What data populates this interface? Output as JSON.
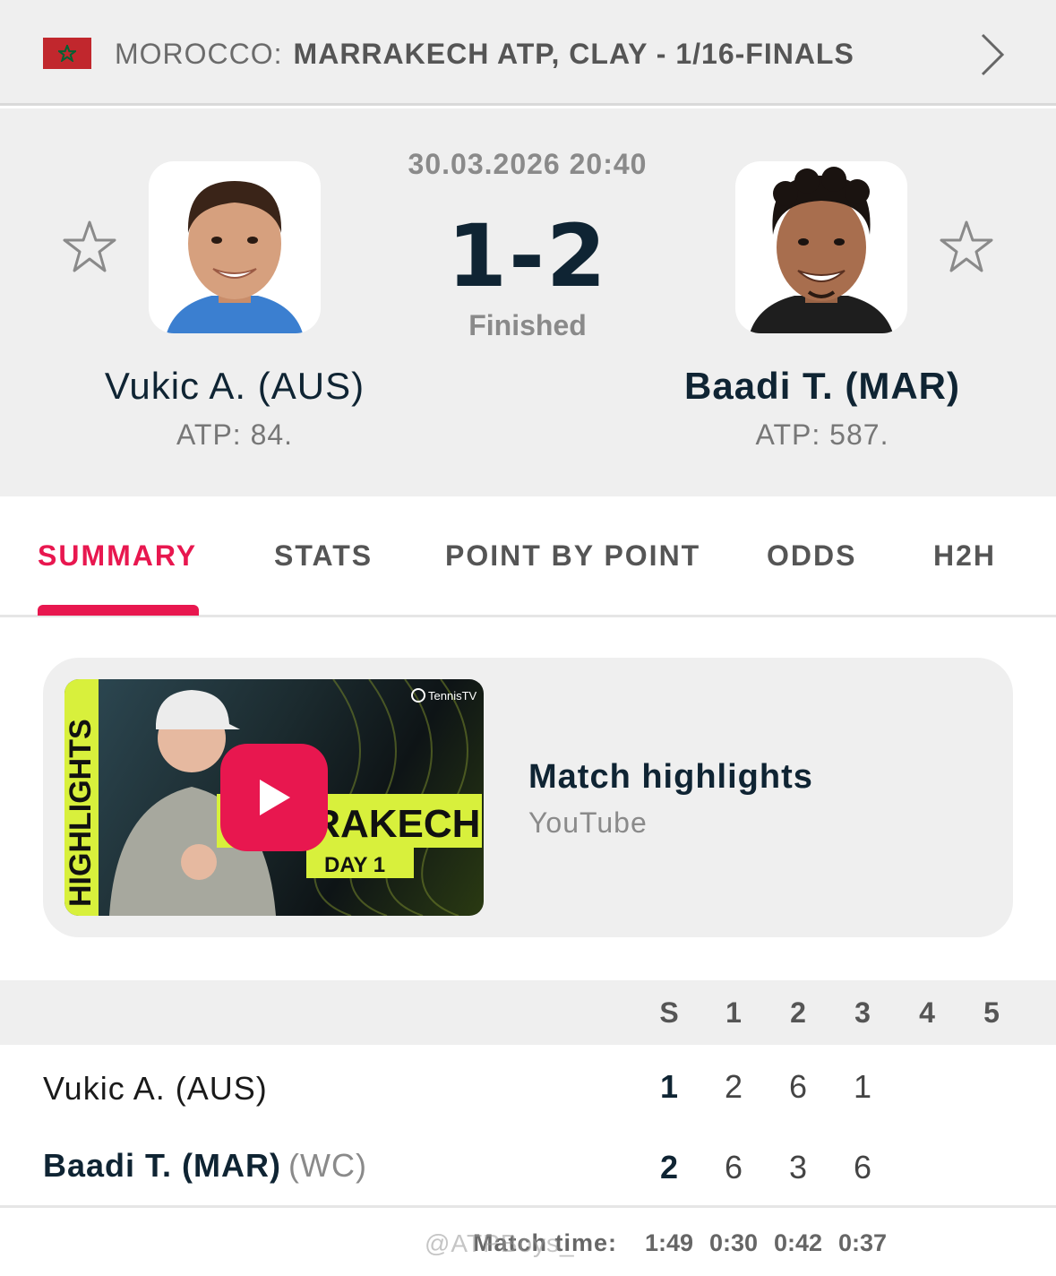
{
  "header": {
    "country": "MOROCCO:",
    "tournament": "MARRAKECH ATP, CLAY - 1/16-FINALS",
    "flag_color": "#c1272d",
    "flag_star_color": "#006233",
    "chevron_icon": "chevron-right-icon"
  },
  "match": {
    "datetime": "30.03.2026 20:40",
    "score": "1-2",
    "status": "Finished",
    "home": {
      "name": "Vukic A. (AUS)",
      "rank": "ATP: 84."
    },
    "away": {
      "name": "Baadi T. (MAR)",
      "rank": "ATP: 587."
    }
  },
  "tabs": [
    {
      "label": "SUMMARY",
      "active": true
    },
    {
      "label": "STATS",
      "active": false
    },
    {
      "label": "POINT BY POINT",
      "active": false
    },
    {
      "label": "ODDS",
      "active": false
    },
    {
      "label": "H2H",
      "active": false
    }
  ],
  "highlights": {
    "title": "Match highlights",
    "source": "YouTube",
    "thumbnail": {
      "side_text": "HIGHLIGHTS",
      "banner": "MARRAKECH",
      "day": "DAY 1",
      "brand": "TennisTV"
    },
    "accent": "#e8174f"
  },
  "scoreboard": {
    "headers": [
      "S",
      "1",
      "2",
      "3",
      "4",
      "5"
    ],
    "rows": [
      {
        "name": "Vukic A. (AUS)",
        "tag": "",
        "total": "1",
        "sets": [
          "2",
          "6",
          "1",
          "",
          ""
        ]
      },
      {
        "name": "Baadi T. (MAR)",
        "tag": "(WC)",
        "total": "2",
        "sets": [
          "6",
          "3",
          "6",
          "",
          ""
        ]
      }
    ],
    "match_time_label": "Match time:",
    "match_times": [
      "1:49",
      "0:30",
      "0:42",
      "0:37"
    ]
  },
  "watermark": "@ATPBoys_"
}
